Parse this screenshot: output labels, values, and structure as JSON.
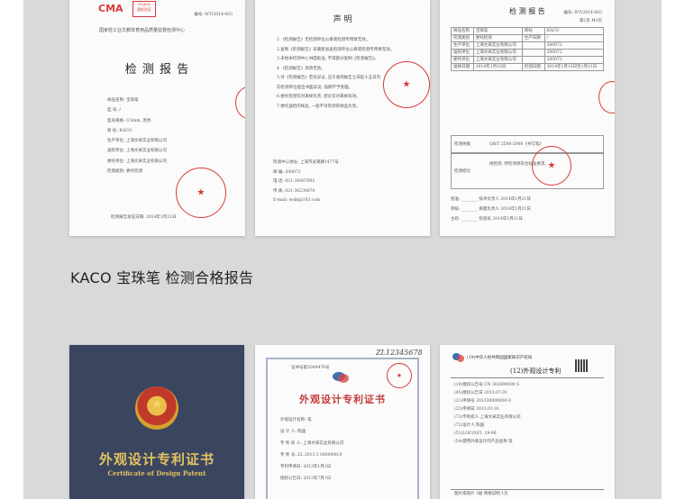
{
  "caption": "KACO 宝珠笔 检测合格报告",
  "doc1": {
    "logo": "CMA",
    "badge_top": "GQJSQ",
    "badge_mid": "国检验证",
    "report_no": "编号: WT/2014-003",
    "center": "国家轻工业文教体育用品质量监督检测中心",
    "title": "检 测 报 告",
    "fields": [
      {
        "k": "样品名称",
        "v": "宝珠笔"
      },
      {
        "k": "型      号",
        "v": "/"
      },
      {
        "k": "型号规格",
        "v": "0.5mm, 黑色"
      },
      {
        "k": "商      标",
        "v": "KACO"
      },
      {
        "k": "生产单位",
        "v": "上海文采实业有限公司"
      },
      {
        "k": "送检单位",
        "v": "上海文采实业有限公司"
      },
      {
        "k": "委托单位",
        "v": "上海文采实业有限公司"
      },
      {
        "k": "检测类别",
        "v": "委托检测"
      }
    ],
    "date": "检测报告发证日期: 2014年1月21日"
  },
  "doc2": {
    "title": "声  明",
    "items": [
      "1.《检测报告》无检测单位公章或检测专用章无效。",
      "2.复制《检测报告》未重新加盖检测单位公章或检测专用章无效。",
      "3.未经本检测中心书面批准, 不得部分复制《检测报告》。",
      "4.《检测报告》涂改无效。",
      "5.对《检测报告》若有异议, 应于收到报告之日起十五日内",
      "向检测单位提出书面异议; 逾期不予受理。",
      "6.委托检测仅对来样负责, 结论仅对来样有效。",
      "7.委托送检的样品, 一般不对检测的样品负责。"
    ],
    "address": "检测中心地址: 上海市武夷路1477号",
    "postcode": "邮    编: 200072",
    "phone": "电    话: 021-36067902",
    "fax": "传    真: 021-36230070",
    "email": "E-mail: wslb@163.com"
  },
  "doc3": {
    "report_no": "编号: WT/2014-003",
    "page": "第2页 共3页",
    "title": "检 测 报 告",
    "rows": [
      [
        "样品名称",
        "宝珠笔",
        "商标",
        "KACO"
      ],
      [
        "检测类别",
        "委托检测",
        "生产日期",
        "/"
      ],
      [
        "生产单位",
        "上海文采实业有限公司",
        "",
        "200072"
      ],
      [
        "送检单位",
        "上海文采实业有限公司",
        "",
        "200072"
      ],
      [
        "委托单位",
        "上海文采实业有限公司",
        "",
        "200072"
      ],
      [
        "送样日期",
        "2014年1月10日",
        "检测日期",
        "2014年1月10日至1月21日"
      ]
    ],
    "basis_label": "检测依据",
    "basis": "QB/T 2586-2008《书写笔》",
    "result_label": "检测结论",
    "result": "经检测, 所检项目符合标准要求。",
    "signers": [
      {
        "role": "批准",
        "title": "技术负责人",
        "date": "2014年1月21日"
      },
      {
        "role": "审核",
        "title": "质量负责人",
        "date": "2014年1月21日"
      },
      {
        "role": "主检",
        "title": "检测员",
        "date": "2014年1月21日"
      }
    ]
  },
  "doc4": {
    "title": "外观设计专利证书",
    "subtitle": "Certificate of Design Patent"
  },
  "doc5": {
    "handwritten": "ZL12345678",
    "cert_no": "证书号第2049476号",
    "title": "外观设计专利证书",
    "lines": [
      "外观设计名称: 笔",
      "设 计 人: 陈国",
      "专 利 权 人: 上海文采实业有限公司",
      "专 利 号: ZL 2013 3 0000000.0",
      "专利申请日: 2013年1月1日",
      "授权公告日: 2013年7月1日"
    ]
  },
  "doc6": {
    "country": "(19)中华人民共和国国家知识产权局",
    "title": "(12)外观设计专利",
    "lines": [
      "(10)授权公告号 CN 302000000 S",
      "(45)授权公告日 2013.07.01",
      "(21)申请号 201330000000.0",
      "(22)申请日 2013.01.01",
      "(73)专利权人 上海文采实业有限公司",
      "(72)设计人 陈国",
      "(51)LOC(9)Cl. 19-06",
      "(54)使用外观设计的产品名称 笔"
    ],
    "footer": "图片或照片 1幅  简要说明 1页"
  }
}
